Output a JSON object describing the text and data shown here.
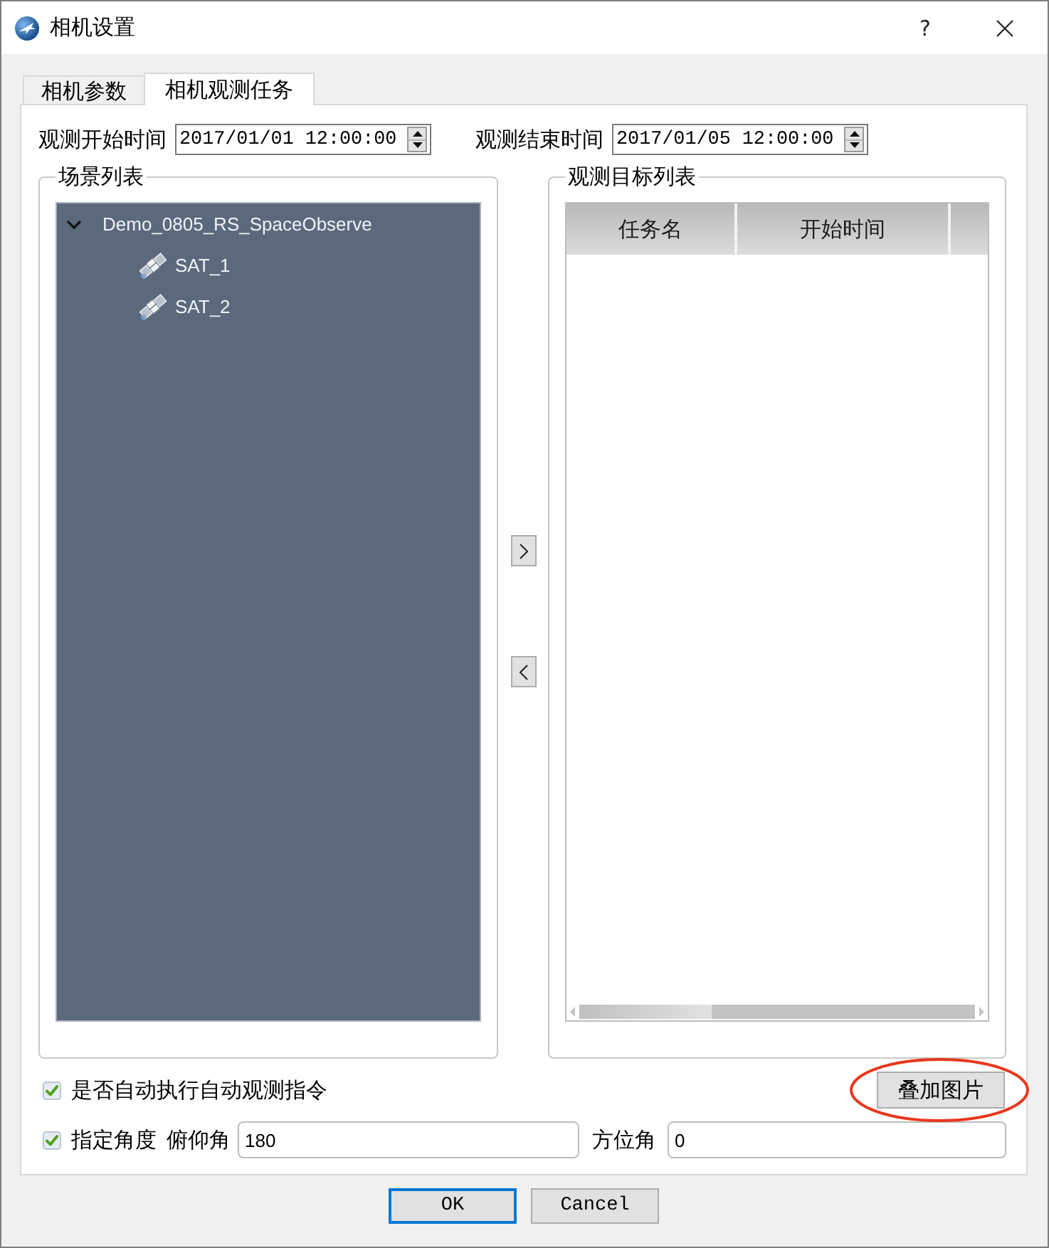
{
  "window": {
    "title": "相机设置",
    "help": "?"
  },
  "tabs": [
    {
      "label": "相机参数",
      "selected": false
    },
    {
      "label": "相机观测任务",
      "selected": true
    }
  ],
  "time_range": [
    {
      "label": "观测开始时间",
      "value": "2017/01/01 12:00:00"
    },
    {
      "label": "观测结束时间",
      "value": "2017/01/05 12:00:00"
    }
  ],
  "scene_list": {
    "title": "场景列表",
    "items": [
      {
        "label": "Demo_0805_RS_SpaceObserve",
        "expanded": true,
        "children": [
          {
            "label": "SAT_1",
            "kind": "satellite"
          },
          {
            "label": "SAT_2",
            "kind": "satellite"
          }
        ]
      }
    ]
  },
  "target_list": {
    "title": "观测目标列表",
    "table": {
      "columns": [
        "任务名",
        "开始时间"
      ]
    }
  },
  "auto_command": {
    "label": "是否自动执行自动观测指令",
    "checked": true
  },
  "overlay_button": {
    "label": "叠加图片",
    "highlighted": true
  },
  "angle": {
    "label": "指定角度",
    "checked": true,
    "fields": [
      {
        "label": "俯仰角",
        "value": "180"
      },
      {
        "label": "方位角",
        "value": "0"
      }
    ]
  },
  "buttons": [
    {
      "label": "OK",
      "focused": true
    },
    {
      "label": "Cancel",
      "focused": false
    }
  ]
}
